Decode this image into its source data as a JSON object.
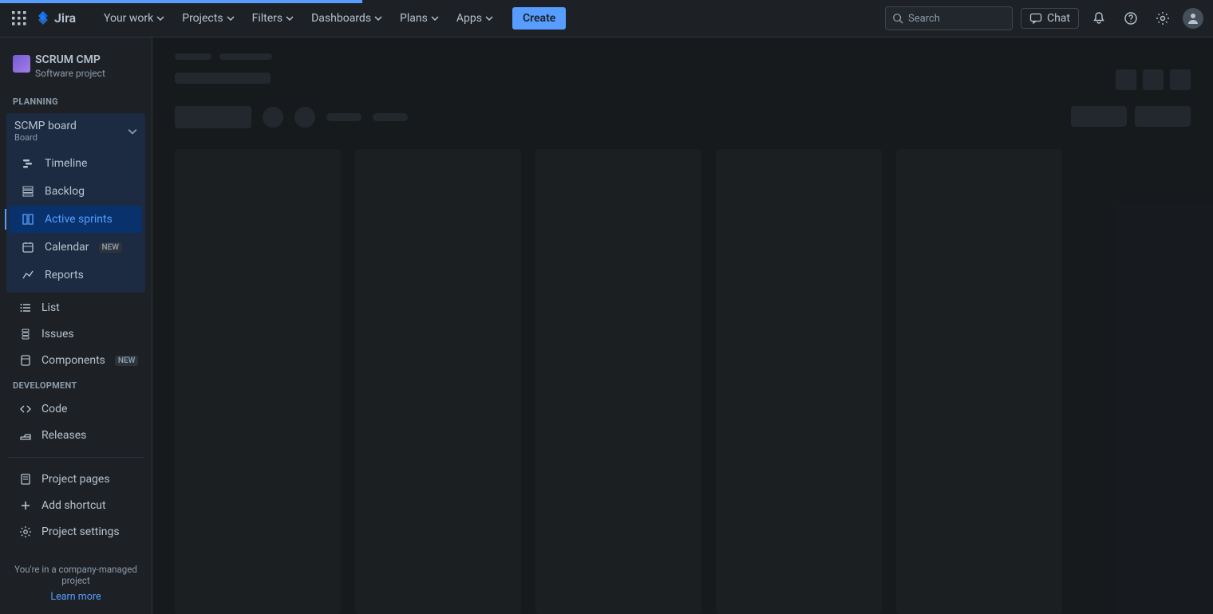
{
  "nav": {
    "items": [
      "Your work",
      "Projects",
      "Filters",
      "Dashboards",
      "Plans",
      "Apps"
    ],
    "create": "Create",
    "search_placeholder": "Search",
    "chat": "Chat"
  },
  "project": {
    "name": "SCRUM CMP",
    "type": "Software project"
  },
  "sidebar": {
    "planning_label": "PLANNING",
    "development_label": "DEVELOPMENT",
    "board": {
      "title": "SCMP board",
      "subtitle": "Board"
    },
    "board_items": [
      {
        "label": "Timeline"
      },
      {
        "label": "Backlog"
      },
      {
        "label": "Active sprints"
      },
      {
        "label": "Calendar",
        "badge": "NEW"
      },
      {
        "label": "Reports"
      }
    ],
    "plain_items": [
      {
        "label": "List"
      },
      {
        "label": "Issues"
      },
      {
        "label": "Components",
        "badge": "NEW"
      }
    ],
    "dev_items": [
      {
        "label": "Code"
      },
      {
        "label": "Releases"
      }
    ],
    "bottom_items": [
      {
        "label": "Project pages"
      },
      {
        "label": "Add shortcut"
      },
      {
        "label": "Project settings"
      }
    ]
  },
  "footer": {
    "message": "You're in a company-managed project",
    "learn_more": "Learn more"
  },
  "icons": {
    "apps_grid": "apps-grid-icon",
    "jira_logo": "jira-logo",
    "chevron_down": "chevron-down-icon",
    "search": "search-icon",
    "chat": "chat-icon",
    "bell": "bell-icon",
    "help": "help-icon",
    "gear": "gear-icon",
    "user": "user-icon",
    "timeline": "timeline-icon",
    "backlog": "backlog-icon",
    "board": "board-icon",
    "calendar": "calendar-icon",
    "reports": "reports-icon",
    "list": "list-icon",
    "issues": "issues-icon",
    "components": "components-icon",
    "code": "code-icon",
    "releases": "releases-icon",
    "page": "page-icon",
    "add": "add-icon",
    "settings": "settings-icon"
  },
  "colors": {
    "accent": "#579dff",
    "bg": "#1d2125",
    "panel": "#22272b",
    "skeleton": "#2c333a"
  }
}
